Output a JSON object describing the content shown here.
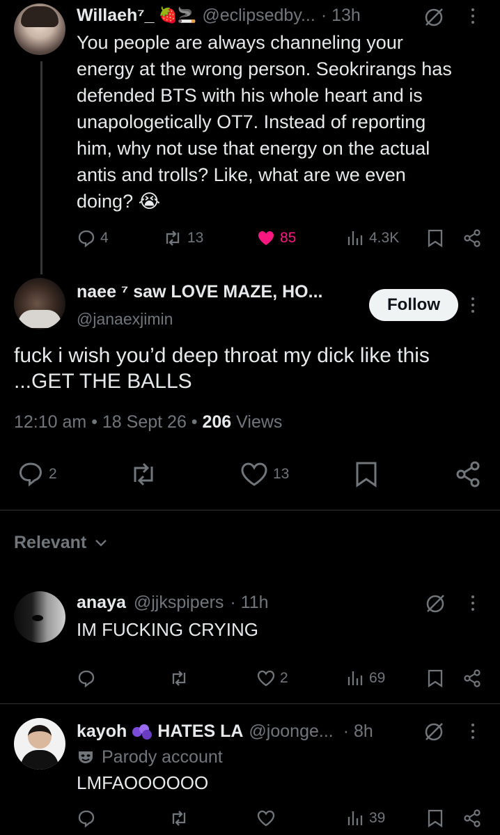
{
  "tweet1": {
    "display_name": "Willaeh⁷_",
    "name_emojis": "🍓🚬",
    "handle": "@eclipsedby...",
    "time": "· 13h",
    "text_lines": [
      "You people are always channeling your",
      "energy at the wrong person. Seokrirangs has",
      "defended BTS with his whole heart and is",
      "unapologetically OT7. Instead of reporting",
      "him, why not use that energy on the actual",
      "antis and trolls? Like, what are we even",
      "doing? 😭"
    ],
    "replies": "4",
    "reposts": "13",
    "likes": "85",
    "views": "4.3K"
  },
  "main_tweet": {
    "display_name": "naee ⁷ saw LOVE MAZE, HO...",
    "handle": "@janaexjimin",
    "follow_label": "Follow",
    "text_lines": [
      "fuck i wish you’d deep throat my dick like this",
      "...GET THE BALLS"
    ],
    "time": "12:10 am",
    "date": "18 Sept 26",
    "views_count": "206",
    "views_label": "Views",
    "replies": "2",
    "likes": "13"
  },
  "filter": {
    "label": "Relevant"
  },
  "reply1": {
    "display_name": "anaya",
    "handle": "@jjkspipers",
    "time": "· 11h",
    "text": "IM FUCKING CRYING",
    "likes": "2",
    "views": "69"
  },
  "reply2": {
    "display_name": "kayoh",
    "name_extra": "HATES LA",
    "handle": "@joonge...",
    "time": "· 8h",
    "badge": "Parody account",
    "text": "LMFAOOOOOO",
    "views": "39"
  },
  "colors": {
    "like_active": "#f91880",
    "muted": "#71767b",
    "text": "#e7e9ea"
  }
}
